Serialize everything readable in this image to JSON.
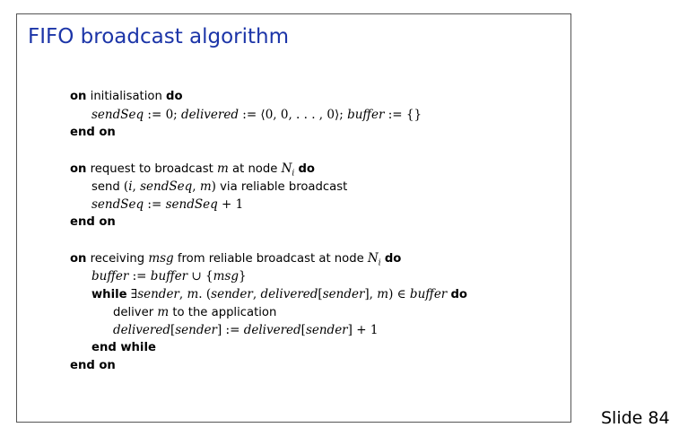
{
  "slide": {
    "title": "FIFO broadcast algorithm",
    "number": "Slide 84"
  },
  "keywords": {
    "on": "on",
    "do": "do",
    "end_on": "end on",
    "while": "while",
    "end_while": "end while"
  },
  "init": {
    "event": "initialisation",
    "sendSeq": "sendSeq",
    "assign_zero": " := 0;  ",
    "delivered": "delivered",
    "assign_vec": " := ⟨0, 0, . . . , 0⟩;  ",
    "buffer": "buffer",
    "assign_set": " := {}"
  },
  "request": {
    "event_pre": "request to broadcast ",
    "m": "m",
    "event_mid": " at node ",
    "N": "N",
    "i_sub": "i",
    "send": "send ",
    "tuple_open": "(",
    "i": "i",
    "comma1": ", ",
    "sendSeq": "sendSeq",
    "comma2": ", ",
    "m2": "m",
    "tuple_close": ")",
    "via": " via reliable broadcast",
    "sendSeq_lhs": "sendSeq",
    "assign": " := ",
    "sendSeq_rhs": "sendSeq",
    "plus_one": " + 1"
  },
  "receive": {
    "event_pre": "receiving ",
    "msg": "msg",
    "event_mid": " from reliable broadcast at node ",
    "N": "N",
    "i_sub": "i",
    "buffer_lhs": "buffer",
    "assign": " := ",
    "buffer_rhs": "buffer",
    "union": " ∪ {",
    "msg2": "msg",
    "close_set": "}",
    "exists": " ∃",
    "sender": "sender",
    "comma": ", ",
    "m": "m",
    "dot": ". (",
    "sender2": "sender",
    "comma2": ", ",
    "delivered": "delivered",
    "bracket_open": "[",
    "sender3": "sender",
    "bracket_close": "], ",
    "m2": "m",
    "in_buffer": ") ∈ ",
    "buffer2": "buffer",
    "deliver_pre": "deliver ",
    "m3": "m",
    "deliver_post": " to the application",
    "delivered_lhs": "delivered",
    "lb1": "[",
    "sender_lhs": "sender",
    "rb1": "]",
    "assign2": " := ",
    "delivered_rhs": "delivered",
    "lb2": "[",
    "sender_rhs": "sender",
    "rb2": "]",
    "plus_one": " + 1"
  }
}
